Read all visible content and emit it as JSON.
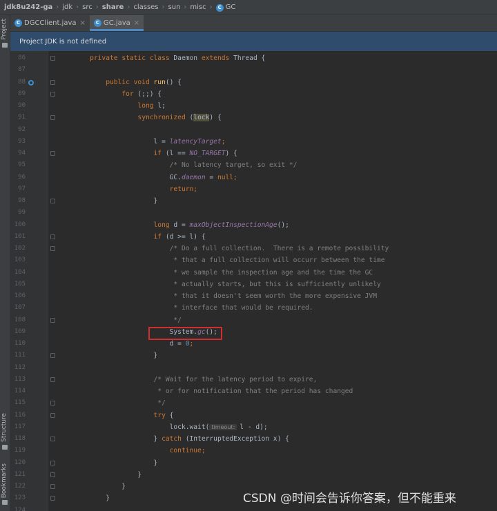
{
  "breadcrumb": [
    "jdk8u242-ga",
    "jdk",
    "src",
    "share",
    "classes",
    "sun",
    "misc",
    "GC"
  ],
  "tool_strip": {
    "project": "Project",
    "structure": "Structure",
    "bookmarks": "Bookmarks"
  },
  "tabs": [
    {
      "label": "DGCClient.java",
      "active": false
    },
    {
      "label": "GC.java",
      "active": true
    }
  ],
  "banner": "Project JDK is not defined",
  "code_lines": [
    {
      "num": "86",
      "parts": [
        [
          "",
          "    "
        ],
        [
          "kw",
          "private static class "
        ],
        [
          "",
          "Daemon "
        ],
        [
          "kw",
          "extends "
        ],
        [
          "",
          "Thread {"
        ]
      ]
    },
    {
      "num": "87",
      "parts": []
    },
    {
      "num": "88",
      "parts": [
        [
          "",
          "        "
        ],
        [
          "kw",
          "public void "
        ],
        [
          "fn",
          "run"
        ],
        [
          "",
          "() {"
        ]
      ]
    },
    {
      "num": "89",
      "parts": [
        [
          "",
          "            "
        ],
        [
          "kw",
          "for "
        ],
        [
          "",
          "(;;) {"
        ]
      ]
    },
    {
      "num": "90",
      "parts": [
        [
          "",
          "                "
        ],
        [
          "kw",
          "long "
        ],
        [
          "",
          "l;"
        ]
      ]
    },
    {
      "num": "91",
      "parts": [
        [
          "",
          "                "
        ],
        [
          "kw",
          "synchronized "
        ],
        [
          "",
          "("
        ],
        [
          "lock",
          "lock"
        ],
        [
          "",
          ") {"
        ]
      ]
    },
    {
      "num": "92",
      "parts": []
    },
    {
      "num": "93",
      "parts": [
        [
          "",
          "                    l = "
        ],
        [
          "it",
          "latencyTarget"
        ],
        [
          "kw",
          ";"
        ]
      ]
    },
    {
      "num": "94",
      "parts": [
        [
          "",
          "                    "
        ],
        [
          "kw",
          "if "
        ],
        [
          "",
          "(l == "
        ],
        [
          "it",
          "NO_TARGET"
        ],
        [
          "",
          ") {"
        ]
      ]
    },
    {
      "num": "95",
      "parts": [
        [
          "",
          "                        "
        ],
        [
          "cm",
          "/* No latency target, so exit */"
        ]
      ]
    },
    {
      "num": "96",
      "parts": [
        [
          "",
          "                        GC."
        ],
        [
          "it",
          "daemon"
        ],
        [
          "",
          " = "
        ],
        [
          "kw",
          "null;"
        ]
      ]
    },
    {
      "num": "97",
      "parts": [
        [
          "",
          "                        "
        ],
        [
          "kw",
          "return;"
        ]
      ]
    },
    {
      "num": "98",
      "parts": [
        [
          "",
          "                    }"
        ]
      ]
    },
    {
      "num": "99",
      "parts": []
    },
    {
      "num": "100",
      "parts": [
        [
          "",
          "                    "
        ],
        [
          "kw",
          "long "
        ],
        [
          "",
          "d = "
        ],
        [
          "it",
          "maxObjectInspectionAge"
        ],
        [
          "",
          "();"
        ]
      ]
    },
    {
      "num": "101",
      "parts": [
        [
          "",
          "                    "
        ],
        [
          "kw",
          "if "
        ],
        [
          "",
          "(d >= l) {"
        ]
      ]
    },
    {
      "num": "102",
      "parts": [
        [
          "",
          "                        "
        ],
        [
          "cm",
          "/* Do a full collection.  There is a remote possibility"
        ]
      ]
    },
    {
      "num": "103",
      "parts": [
        [
          "",
          "                         "
        ],
        [
          "cm",
          "* that a full collection will occurr between the time"
        ]
      ]
    },
    {
      "num": "104",
      "parts": [
        [
          "",
          "                         "
        ],
        [
          "cm",
          "* we sample the inspection age and the time the GC"
        ]
      ]
    },
    {
      "num": "105",
      "parts": [
        [
          "",
          "                         "
        ],
        [
          "cm",
          "* actually starts, but this is sufficiently unlikely"
        ]
      ]
    },
    {
      "num": "106",
      "parts": [
        [
          "",
          "                         "
        ],
        [
          "cm",
          "* that it doesn't seem worth the more expensive JVM"
        ]
      ]
    },
    {
      "num": "107",
      "parts": [
        [
          "",
          "                         "
        ],
        [
          "cm",
          "* interface that would be required."
        ]
      ]
    },
    {
      "num": "108",
      "parts": [
        [
          "",
          "                         "
        ],
        [
          "cm",
          "*/"
        ]
      ]
    },
    {
      "num": "109",
      "parts": [
        [
          "",
          "                        System."
        ],
        [
          "it",
          "gc"
        ],
        [
          "",
          "();"
        ]
      ]
    },
    {
      "num": "110",
      "parts": [
        [
          "",
          "                        d = "
        ],
        [
          "num",
          "0"
        ],
        [
          "kw",
          ";"
        ]
      ]
    },
    {
      "num": "111",
      "parts": [
        [
          "",
          "                    }"
        ]
      ]
    },
    {
      "num": "112",
      "parts": []
    },
    {
      "num": "113",
      "parts": [
        [
          "",
          "                    "
        ],
        [
          "cm",
          "/* Wait for the latency period to expire,"
        ]
      ]
    },
    {
      "num": "114",
      "parts": [
        [
          "",
          "                     "
        ],
        [
          "cm",
          "* or for notification that the period has changed"
        ]
      ]
    },
    {
      "num": "115",
      "parts": [
        [
          "",
          "                     "
        ],
        [
          "cm",
          "*/"
        ]
      ]
    },
    {
      "num": "116",
      "parts": [
        [
          "",
          "                    "
        ],
        [
          "kw",
          "try "
        ],
        [
          "",
          "{"
        ]
      ]
    },
    {
      "num": "117",
      "parts": [
        [
          "",
          "                        lock.wait("
        ],
        [
          "hint",
          "timeout:"
        ],
        [
          "",
          "l - d);"
        ]
      ]
    },
    {
      "num": "118",
      "parts": [
        [
          "",
          "                    } "
        ],
        [
          "kw",
          "catch "
        ],
        [
          "",
          "(InterruptedException x) {"
        ]
      ]
    },
    {
      "num": "119",
      "parts": [
        [
          "",
          "                        "
        ],
        [
          "kw",
          "continue;"
        ]
      ]
    },
    {
      "num": "120",
      "parts": [
        [
          "",
          "                    }"
        ]
      ]
    },
    {
      "num": "121",
      "parts": [
        [
          "",
          "                }"
        ]
      ]
    },
    {
      "num": "122",
      "parts": [
        [
          "",
          "            }"
        ]
      ]
    },
    {
      "num": "123",
      "parts": [
        [
          "",
          "        }"
        ]
      ]
    },
    {
      "num": "124",
      "parts": []
    }
  ],
  "watermark": "CSDN @时间会告诉你答案，但不能重来",
  "colors": {
    "keyword": "#cc7832",
    "method": "#ffc66d",
    "field": "#9876aa",
    "number": "#6897bb",
    "comment": "#808080",
    "text": "#a9b7c6",
    "highlight_box": "#d02f2f"
  }
}
